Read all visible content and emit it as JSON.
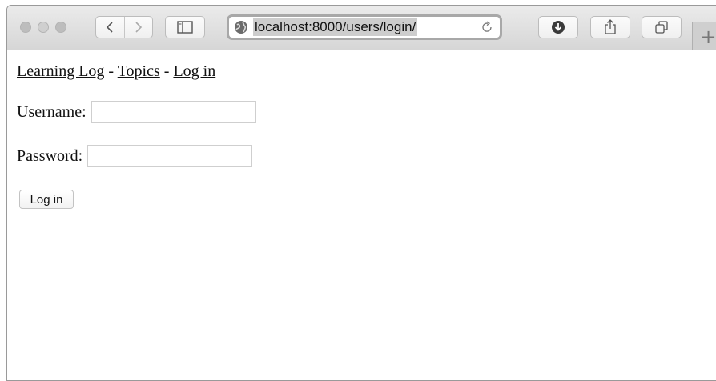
{
  "browser": {
    "address": "localhost:8000/users/login/",
    "new_tab_label": "+",
    "icons": [
      "back-icon",
      "forward-icon",
      "sidebar-icon",
      "globe-icon",
      "reload-icon",
      "download-icon",
      "share-icon",
      "tabs-icon"
    ]
  },
  "page": {
    "nav": {
      "home_link": "Learning Log",
      "sep1": " - ",
      "topics_link": "Topics",
      "sep2": " - ",
      "login_link": "Log in"
    },
    "form": {
      "username_label": "Username:",
      "username_value": "",
      "password_label": "Password:",
      "password_value": "",
      "submit_label": "Log in"
    }
  }
}
